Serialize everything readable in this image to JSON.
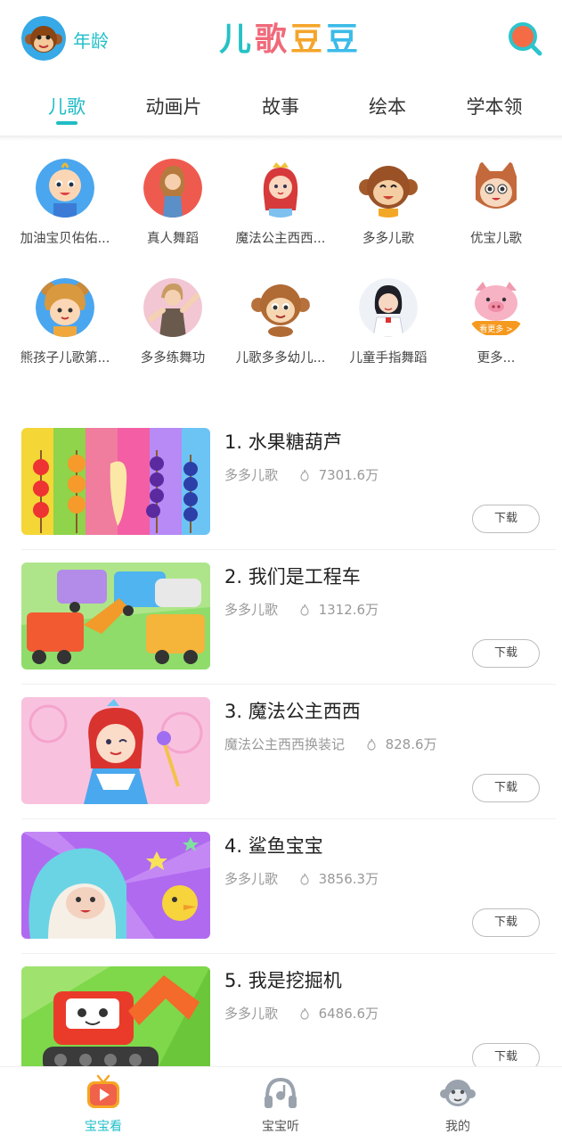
{
  "header": {
    "age_label": "年龄",
    "logo_text": "儿歌豆豆",
    "search_icon": "search-icon",
    "accent_color": "#20bcc6"
  },
  "tabs": [
    {
      "label": "儿歌",
      "active": true
    },
    {
      "label": "动画片",
      "active": false
    },
    {
      "label": "故事",
      "active": false
    },
    {
      "label": "绘本",
      "active": false
    },
    {
      "label": "学本领",
      "active": false
    }
  ],
  "channels": [
    {
      "label": "加油宝贝佑佑..."
    },
    {
      "label": "真人舞蹈"
    },
    {
      "label": "魔法公主西西..."
    },
    {
      "label": "多多儿歌"
    },
    {
      "label": "优宝儿歌"
    },
    {
      "label": "熊孩子儿歌第..."
    },
    {
      "label": "多多练舞功"
    },
    {
      "label": "儿歌多多幼儿..."
    },
    {
      "label": "儿童手指舞蹈"
    },
    {
      "label": "更多...",
      "badge": "看更多 >"
    }
  ],
  "songs": [
    {
      "title": "1. 水果糖葫芦",
      "channel": "多多儿歌",
      "plays": "7301.6万",
      "download_label": "下载"
    },
    {
      "title": "2. 我们是工程车",
      "channel": "多多儿歌",
      "plays": "1312.6万",
      "download_label": "下载"
    },
    {
      "title": "3. 魔法公主西西",
      "channel": "魔法公主西西换装记",
      "plays": "828.6万",
      "download_label": "下载"
    },
    {
      "title": "4. 鲨鱼宝宝",
      "channel": "多多儿歌",
      "plays": "3856.3万",
      "download_label": "下载"
    },
    {
      "title": "5. 我是挖掘机",
      "channel": "多多儿歌",
      "plays": "6486.6万",
      "download_label": "下载"
    }
  ],
  "bottom_nav": [
    {
      "label": "宝宝看",
      "icon": "tv-play-icon",
      "active": true
    },
    {
      "label": "宝宝听",
      "icon": "headphones-icon",
      "active": false
    },
    {
      "label": "我的",
      "icon": "monkey-face-icon",
      "active": false
    }
  ]
}
